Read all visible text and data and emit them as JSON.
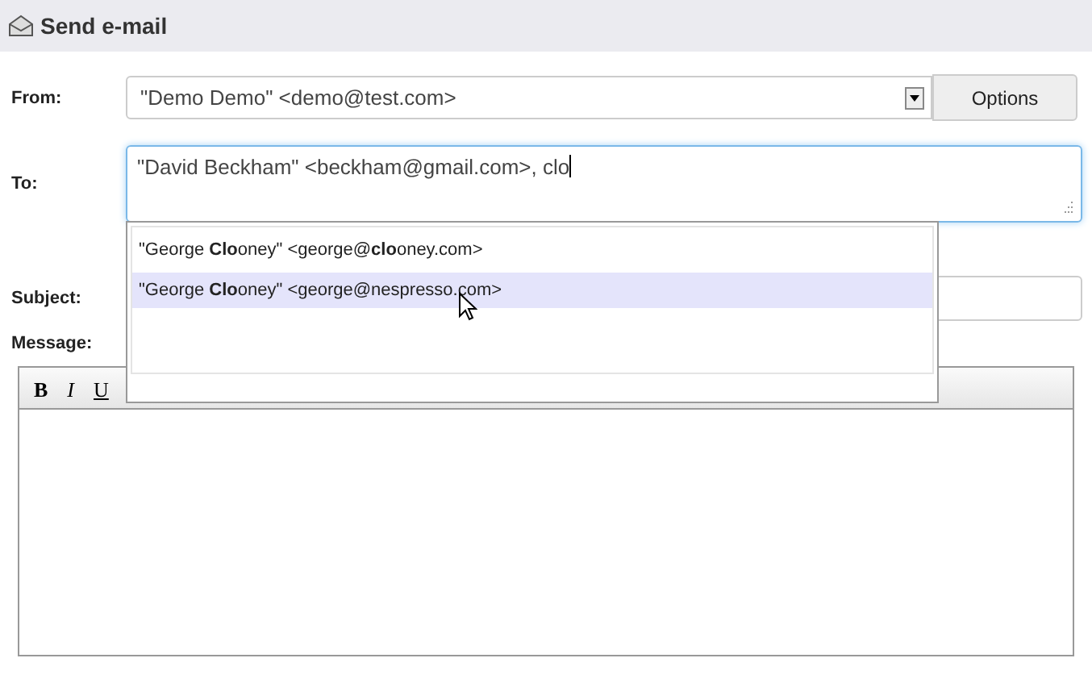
{
  "header": {
    "title": "Send e-mail"
  },
  "from": {
    "label": "From:",
    "value": "\"Demo Demo\" <demo@test.com>",
    "options_button": "Options"
  },
  "to": {
    "label": "To:",
    "value": "\"David Beckham\" <beckham@gmail.com>, clo"
  },
  "suggestions": [
    {
      "text": "\"George **Clo**oney\" <george@**clo**oney.com>",
      "selected": false
    },
    {
      "text": "\"George **Clo**oney\" <george@nespresso.com>",
      "selected": true
    }
  ],
  "subject": {
    "label": "Subject:"
  },
  "message": {
    "label": "Message:",
    "toolbar": [
      "B",
      "I",
      "U"
    ]
  }
}
